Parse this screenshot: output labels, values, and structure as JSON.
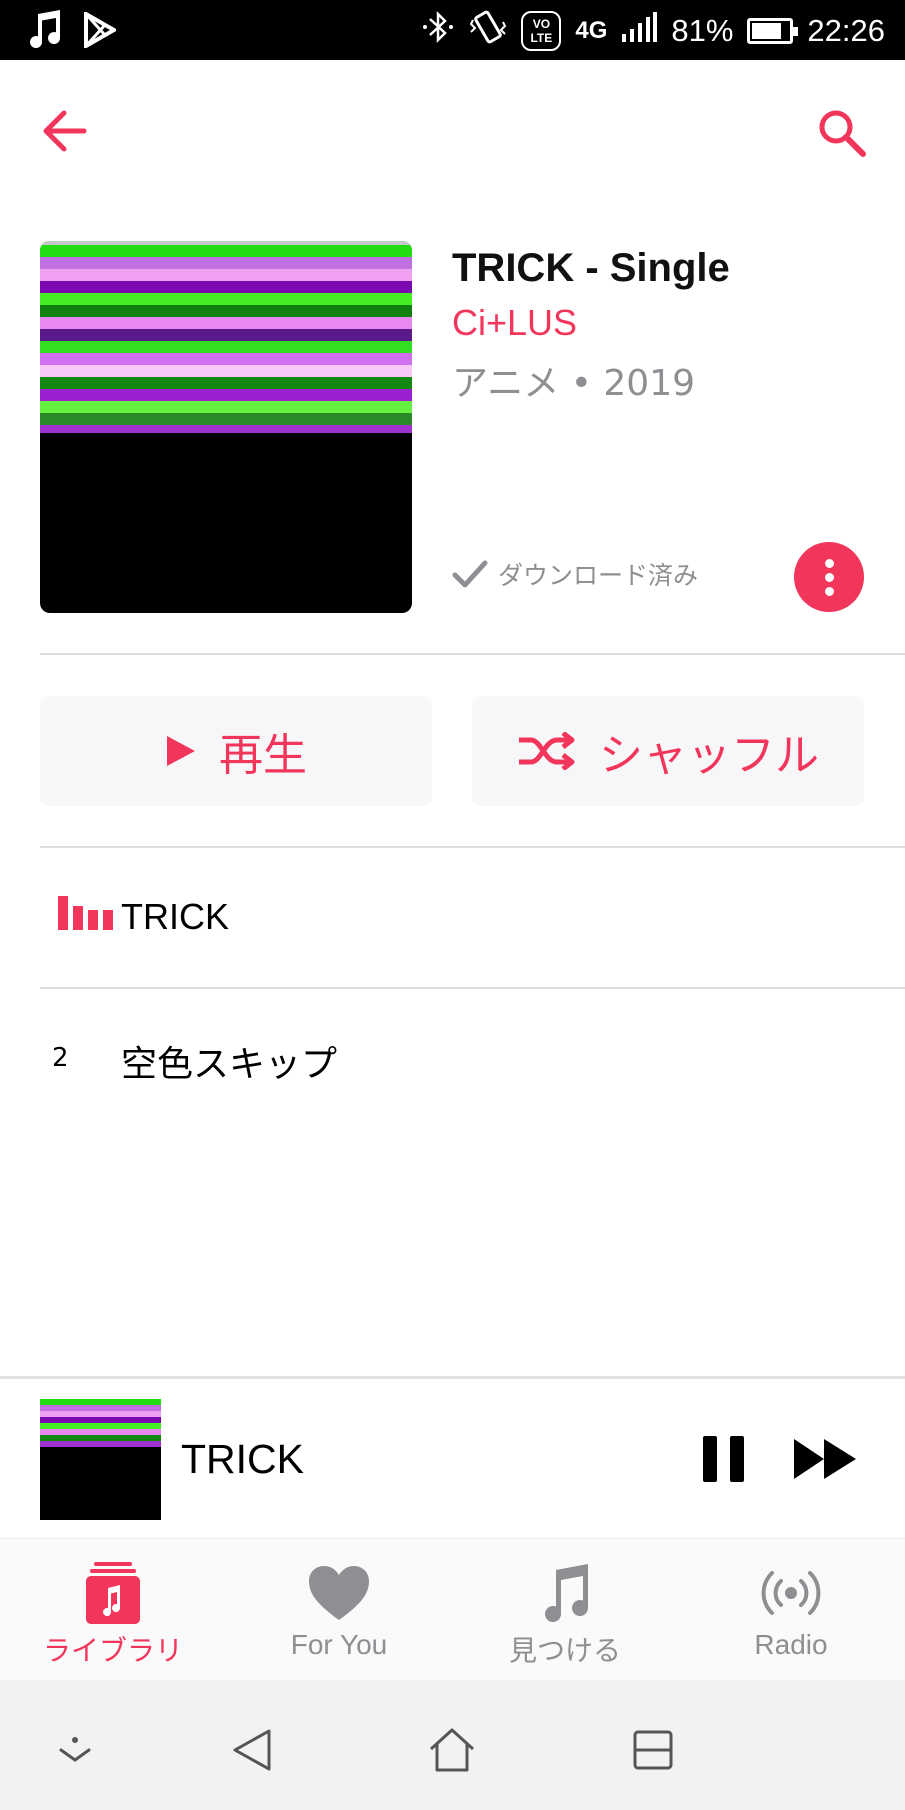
{
  "status_bar": {
    "battery_percent": "81%",
    "battery_level": 0.81,
    "time": "22:26",
    "network": "4G",
    "lte_label_top": "VO",
    "lte_label_bottom": "LTE"
  },
  "header": {
    "back_icon": "arrow-left-icon",
    "search_icon": "search-icon"
  },
  "album": {
    "title": "TRICK - Single",
    "artist": "Ci+LUS",
    "meta": "アニメ • 2019",
    "downloaded_label": "ダウンロード済み"
  },
  "actions": {
    "play_label": "再生",
    "shuffle_label": "シャッフル"
  },
  "tracks": [
    {
      "number": "",
      "title": "TRICK",
      "now_playing": true
    },
    {
      "number": "2",
      "title": "空色スキップ",
      "now_playing": false
    }
  ],
  "mini_player": {
    "title": "TRICK"
  },
  "tabs": [
    {
      "label": "ライブラリ",
      "icon": "library-icon",
      "active": true
    },
    {
      "label": "For You",
      "icon": "heart-icon",
      "active": false
    },
    {
      "label": "見つける",
      "icon": "music-note-icon",
      "active": false
    },
    {
      "label": "Radio",
      "icon": "radio-icon",
      "active": false
    }
  ],
  "colors": {
    "accent": "#f2355b",
    "inactive": "#8e8e93"
  }
}
